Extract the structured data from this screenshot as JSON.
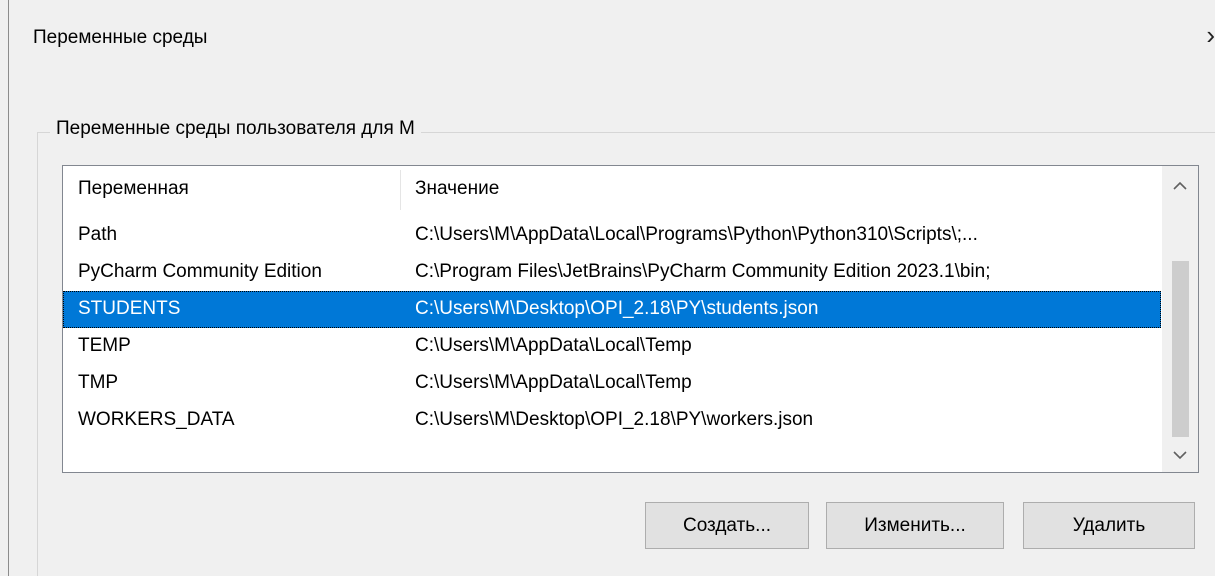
{
  "dialog": {
    "title": "Переменные среды",
    "close_glyph": "›"
  },
  "user_group": {
    "legend": "Переменные среды пользователя для M"
  },
  "table": {
    "headers": [
      "Переменная",
      "Значение"
    ],
    "rows": [
      {
        "name": "Path",
        "value": "C:\\Users\\M\\AppData\\Local\\Programs\\Python\\Python310\\Scripts\\;..."
      },
      {
        "name": "PyCharm Community Edition",
        "value": "C:\\Program Files\\JetBrains\\PyCharm Community Edition 2023.1\\bin;"
      },
      {
        "name": "STUDENTS",
        "value": "C:\\Users\\M\\Desktop\\OPI_2.18\\PY\\students.json",
        "selected": true
      },
      {
        "name": "TEMP",
        "value": "C:\\Users\\M\\AppData\\Local\\Temp"
      },
      {
        "name": "TMP",
        "value": "C:\\Users\\M\\AppData\\Local\\Temp"
      },
      {
        "name": "WORKERS_DATA",
        "value": "C:\\Users\\M\\Desktop\\OPI_2.18\\PY\\workers.json"
      }
    ]
  },
  "scrollbar": {
    "up_glyph": "⌃",
    "down_glyph": "⌄"
  },
  "buttons": {
    "create": "Создать...",
    "edit": "Изменить...",
    "delete": "Удалить"
  },
  "colors": {
    "selection": "#0078d7",
    "window_bg": "#f0f0f0"
  }
}
